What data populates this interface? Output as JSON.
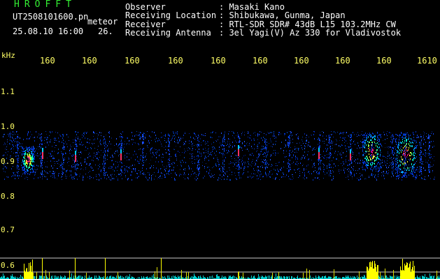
{
  "header": {
    "logo": "HROFFT",
    "filename": "UT2508101600.pn",
    "tag": "meteor",
    "datetime": "25.08.10 16:00",
    "number": "26."
  },
  "info": [
    {
      "label": "Observer",
      "value": ": Masaki Kano"
    },
    {
      "label": "Receiving Location",
      "value": ": Shibukawa, Gunma, Japan"
    },
    {
      "label": "Receiver",
      "value": ": RTL-SDR SDR# 43dB L15 103.2MHz CW"
    },
    {
      "label": "Receiving Antenna",
      "value": ": 3el Yagi(V) Az 330 for Vladivostok"
    }
  ],
  "axis": {
    "unit": "kHz",
    "y_ticks": [
      "1.1",
      "1.0",
      "0.9",
      "0.8",
      "0.7",
      "0.6"
    ],
    "x_ticks": [
      "160",
      "160",
      "160",
      "160",
      "160",
      "160",
      "160",
      "160",
      "160",
      "1610"
    ]
  },
  "colors": {
    "background": "#000000",
    "label_text": "#ffffff",
    "axis_text": "#ffff66",
    "logo_text": "#33ee33"
  }
}
